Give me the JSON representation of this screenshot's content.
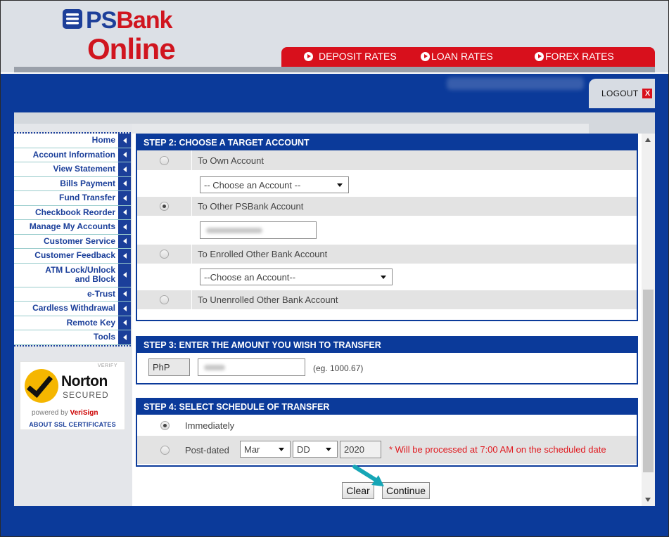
{
  "brand": {
    "line1_a": "PS",
    "line1_b": "Bank",
    "line2": "Online",
    "color_blue": "#1d3f99",
    "color_red": "#d0151f"
  },
  "rates_bar": [
    {
      "label": "DEPOSIT RATES",
      "icon": "play-circle-icon"
    },
    {
      "label": "LOAN RATES",
      "icon": "play-circle-icon"
    },
    {
      "label": "FOREX RATES",
      "icon": "play-circle-icon"
    }
  ],
  "logout": {
    "label": "LOGOUT",
    "icon_text": "X"
  },
  "sidebar": {
    "items": [
      {
        "label": "Home"
      },
      {
        "label": "Account Information"
      },
      {
        "label": "View Statement"
      },
      {
        "label": "Bills Payment"
      },
      {
        "label": "Fund Transfer"
      },
      {
        "label": "Checkbook Reorder"
      },
      {
        "label": "Manage My Accounts"
      },
      {
        "label": "Customer Service"
      },
      {
        "label": "Customer Feedback"
      },
      {
        "label": "ATM Lock/Unlock and Block"
      },
      {
        "label": "e-Trust"
      },
      {
        "label": "Cardless Withdrawal"
      },
      {
        "label": "Remote Key"
      },
      {
        "label": "Tools"
      }
    ]
  },
  "norton": {
    "verify": "VERIFY",
    "brand": "Norton",
    "secured": "SECURED",
    "powered_prefix": "powered by ",
    "powered_brand": "VeriSign",
    "ssl_link": "ABOUT SSL CERTIFICATES"
  },
  "step2": {
    "title": "STEP 2: CHOOSE A TARGET ACCOUNT",
    "options": [
      {
        "label": "To Own Account",
        "selected": false
      },
      {
        "label": "To Other PSBank Account",
        "selected": true
      },
      {
        "label": "To Enrolled Other Bank Account",
        "selected": false
      },
      {
        "label": "To Unenrolled Other Bank Account",
        "selected": false
      }
    ],
    "own_account_select": "-- Choose an Account --",
    "enrolled_select": "--Choose an Account--"
  },
  "step3": {
    "title": "STEP 3: ENTER THE AMOUNT YOU WISH TO TRANSFER",
    "currency": "PhP",
    "hint": "(eg. 1000.67)"
  },
  "step4": {
    "title": "STEP 4: SELECT SCHEDULE OF TRANSFER",
    "immediately": "Immediately",
    "postdated": "Post-dated",
    "month": "Mar",
    "day": "DD",
    "year": "2020",
    "note": "* Will be processed at 7:00 AM on the scheduled date",
    "note_color": "#e0191f"
  },
  "actions": {
    "clear": "Clear",
    "continue": "Continue"
  }
}
